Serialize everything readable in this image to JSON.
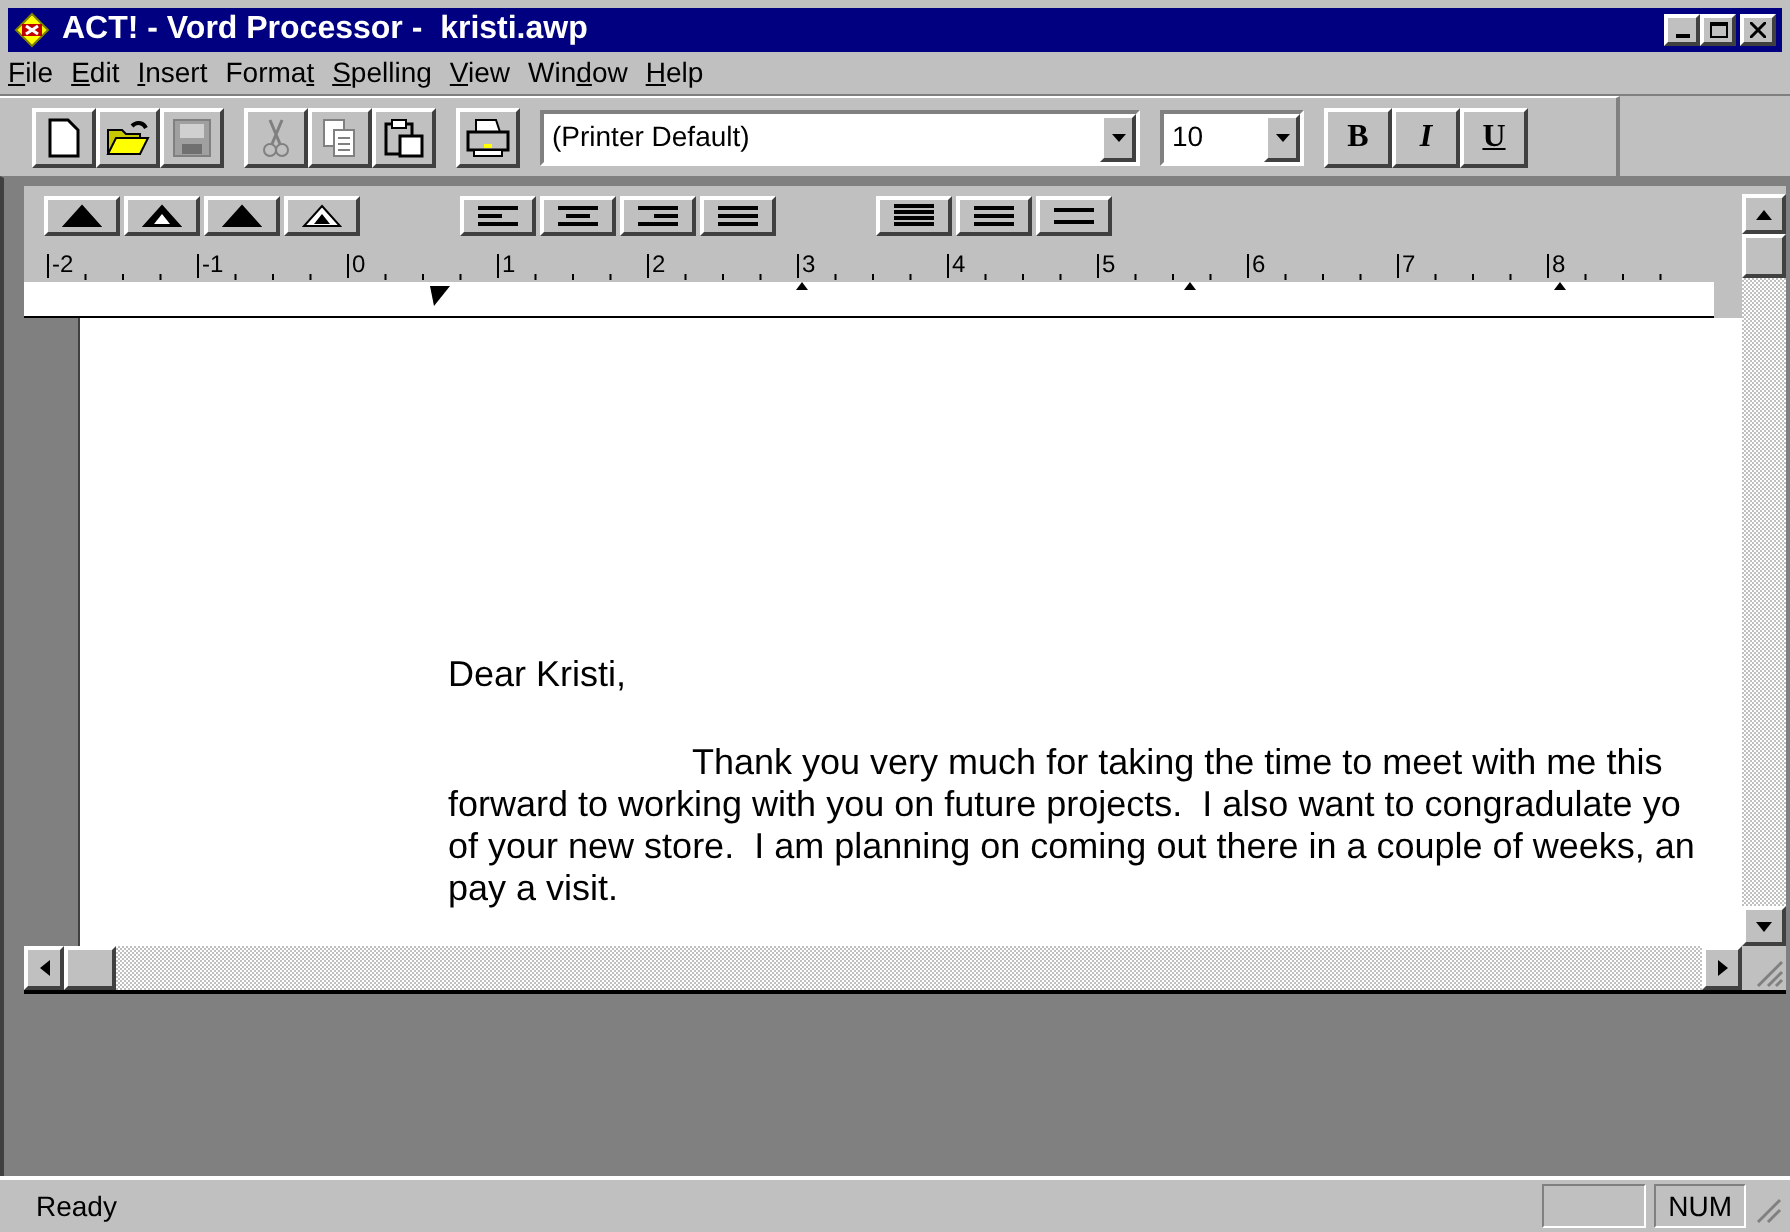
{
  "window": {
    "title": "ACT! - Vord Processor -  kristi.awp"
  },
  "menu": [
    {
      "key": "F",
      "post": "ile"
    },
    {
      "key": "E",
      "post": "dit"
    },
    {
      "key": "I",
      "post": "nsert"
    },
    {
      "pre": "Forma",
      "key": "t"
    },
    {
      "key": "S",
      "post": "pelling"
    },
    {
      "key": "V",
      "post": "iew"
    },
    {
      "pre": "Win",
      "key": "d",
      "post": "ow"
    },
    {
      "key": "H",
      "post": "elp"
    }
  ],
  "toolbar": {
    "groups": [
      [
        {
          "kind": "new",
          "disabled": false
        },
        {
          "kind": "open",
          "disabled": false
        },
        {
          "kind": "save",
          "disabled": true
        }
      ],
      [
        {
          "kind": "cut",
          "disabled": true
        },
        {
          "kind": "copy",
          "disabled": true
        },
        {
          "kind": "paste",
          "disabled": false
        }
      ],
      [
        {
          "kind": "print",
          "disabled": false
        }
      ]
    ],
    "font": {
      "value": "(Printer Default)"
    },
    "size": {
      "value": "10"
    },
    "styles": [
      {
        "kind": "bold",
        "label": "B"
      },
      {
        "kind": "italic",
        "label": "I"
      },
      {
        "kind": "underline",
        "label": "U"
      }
    ]
  },
  "paragraph_bar": {
    "groups": [
      [
        {
          "kind": "indent-first"
        },
        {
          "kind": "indent-left"
        },
        {
          "kind": "indent-right"
        },
        {
          "kind": "indent-hanging"
        }
      ],
      [
        {
          "kind": "align-left"
        },
        {
          "kind": "align-center"
        },
        {
          "kind": "align-right"
        },
        {
          "kind": "justify"
        }
      ],
      [
        {
          "kind": "spacing-single"
        },
        {
          "kind": "spacing-half"
        },
        {
          "kind": "spacing-double"
        }
      ]
    ]
  },
  "ruler": {
    "labels": [
      "-2",
      "-1",
      "0",
      "1",
      "2",
      "3",
      "4",
      "5",
      "6",
      "7",
      "8"
    ]
  },
  "document": {
    "greeting": "Dear Kristi,",
    "lines": [
      "Thank you very much for taking the time to meet with me this",
      "forward to working with you on future projects.  I also want to congradulate yo",
      "of your new store.  I am planning on coming out there in a couple of weeks, an",
      "pay a visit."
    ]
  },
  "status_bar": {
    "message": "Ready",
    "panels": [
      {
        "kind": "blank"
      },
      {
        "kind": "text",
        "text": "NUM"
      }
    ]
  }
}
